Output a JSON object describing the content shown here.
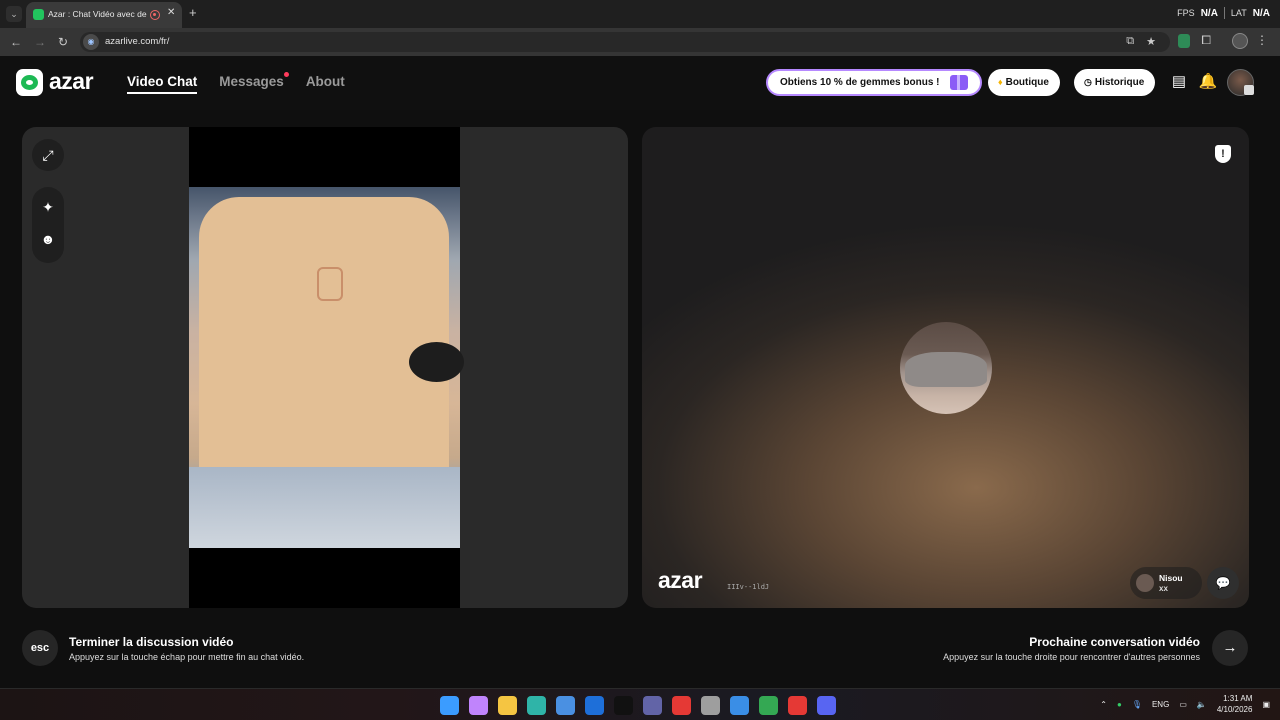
{
  "browser": {
    "tab_title": "Azar : Chat Vidéo avec de n",
    "url": "azarlive.com/fr/",
    "perf": {
      "fps_label": "FPS",
      "fps_value": "N/A",
      "lat_label": "LAT",
      "lat_value": "N/A"
    }
  },
  "header": {
    "logo": "azar",
    "nav": [
      "Video Chat",
      "Messages",
      "About"
    ],
    "promo": "Obtiens 10 % de gemmes bonus !",
    "shop": "Boutique",
    "history": "Historique"
  },
  "peer": {
    "watermark": "azar",
    "session_id": "IIIv--1ldJ",
    "name": "Nisou",
    "sub": "xx"
  },
  "footer": {
    "esc_key": "esc",
    "end_title": "Terminer la discussion vidéo",
    "end_sub": "Appuyez sur la touche échap pour mettre fin au chat vidéo.",
    "next_title": "Prochaine conversation vidéo",
    "next_sub": "Appuyez sur la touche droite pour rencontrer d'autres personnes"
  },
  "taskbar": {
    "lang": "ENG",
    "time": "1:31 AM",
    "date": "4/10/2026",
    "icons": [
      "windows-start",
      "copilot",
      "file-explorer",
      "edge",
      "ms-store",
      "outlook",
      "tiktok",
      "teams",
      "app-red",
      "settings",
      "photos",
      "chrome",
      "app-red-2",
      "discord"
    ],
    "icon_colors": [
      "#3b9cff",
      "#c084fc",
      "#f5c542",
      "#2fb4a8",
      "#4a90e2",
      "#1e6fd9",
      "#111111",
      "#6264a7",
      "#e53935",
      "#9e9e9e",
      "#3a8ee6",
      "#34a853",
      "#e53935",
      "#5865f2"
    ]
  },
  "colors": {
    "accent_green": "#1db954",
    "promo_border": "#b689ff",
    "notif_dot": "#ff3b5c"
  }
}
